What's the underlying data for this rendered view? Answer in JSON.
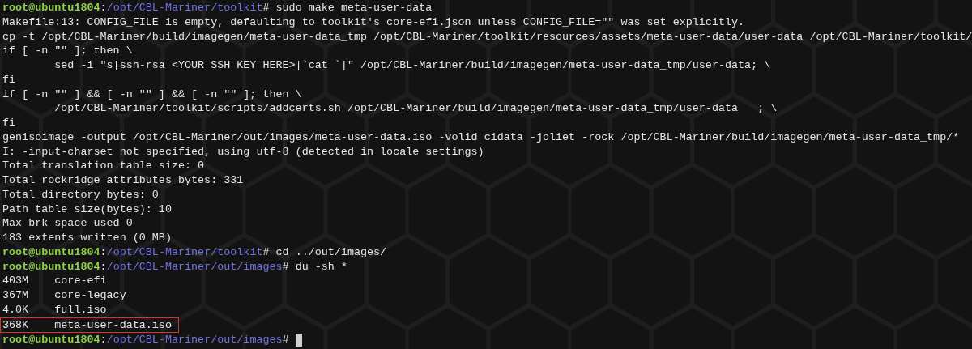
{
  "terminal": {
    "lines": [
      {
        "kind": "prompt",
        "user": "root@ubuntu1804",
        "sep": ":",
        "path": "/opt/CBL-Mariner/toolkit",
        "command": "# sudo make meta-user-data",
        "cursor": false
      },
      {
        "kind": "output",
        "text": "Makefile:13: CONFIG_FILE is empty, defaulting to toolkit's core-efi.json unless CONFIG_FILE=\"\" was set explicitly.",
        "highlighted": false
      },
      {
        "kind": "output",
        "text": "cp -t /opt/CBL-Mariner/build/imagegen/meta-user-data_tmp /opt/CBL-Mariner/toolkit/resources/assets/meta-user-data/user-data /opt/CBL-Mariner/toolkit/",
        "highlighted": false
      },
      {
        "kind": "output",
        "text": "if [ -n \"\" ]; then \\",
        "highlighted": false
      },
      {
        "kind": "output",
        "text": "        sed -i \"s|ssh-rsa <YOUR SSH KEY HERE>|`cat `|\" /opt/CBL-Mariner/build/imagegen/meta-user-data_tmp/user-data; \\",
        "highlighted": false
      },
      {
        "kind": "output",
        "text": "fi",
        "highlighted": false
      },
      {
        "kind": "output",
        "text": "if [ -n \"\" ] && [ -n \"\" ] && [ -n \"\" ]; then \\",
        "highlighted": false
      },
      {
        "kind": "output",
        "text": "        /opt/CBL-Mariner/toolkit/scripts/addcerts.sh /opt/CBL-Mariner/build/imagegen/meta-user-data_tmp/user-data   ; \\",
        "highlighted": false
      },
      {
        "kind": "output",
        "text": "fi",
        "highlighted": false
      },
      {
        "kind": "output",
        "text": "genisoimage -output /opt/CBL-Mariner/out/images/meta-user-data.iso -volid cidata -joliet -rock /opt/CBL-Mariner/build/imagegen/meta-user-data_tmp/*",
        "highlighted": false
      },
      {
        "kind": "output",
        "text": "I: -input-charset not specified, using utf-8 (detected in locale settings)",
        "highlighted": false
      },
      {
        "kind": "output",
        "text": "Total translation table size: 0",
        "highlighted": false
      },
      {
        "kind": "output",
        "text": "Total rockridge attributes bytes: 331",
        "highlighted": false
      },
      {
        "kind": "output",
        "text": "Total directory bytes: 0",
        "highlighted": false
      },
      {
        "kind": "output",
        "text": "Path table size(bytes): 10",
        "highlighted": false
      },
      {
        "kind": "output",
        "text": "Max brk space used 0",
        "highlighted": false
      },
      {
        "kind": "output",
        "text": "183 extents written (0 MB)",
        "highlighted": false
      },
      {
        "kind": "prompt",
        "user": "root@ubuntu1804",
        "sep": ":",
        "path": "/opt/CBL-Mariner/toolkit",
        "command": "# cd ../out/images/",
        "cursor": false
      },
      {
        "kind": "prompt",
        "user": "root@ubuntu1804",
        "sep": ":",
        "path": "/opt/CBL-Mariner/out/images",
        "command": "# du -sh *",
        "cursor": false
      },
      {
        "kind": "output",
        "text": "403M    core-efi",
        "highlighted": false
      },
      {
        "kind": "output",
        "text": "367M    core-legacy",
        "highlighted": false
      },
      {
        "kind": "output",
        "text": "4.0K    full.iso",
        "highlighted": false
      },
      {
        "kind": "output",
        "text": "368K    meta-user-data.iso",
        "highlighted": true
      },
      {
        "kind": "prompt",
        "user": "root@ubuntu1804",
        "sep": ":",
        "path": "/opt/CBL-Mariner/out/images",
        "command": "# ",
        "cursor": true
      }
    ]
  }
}
